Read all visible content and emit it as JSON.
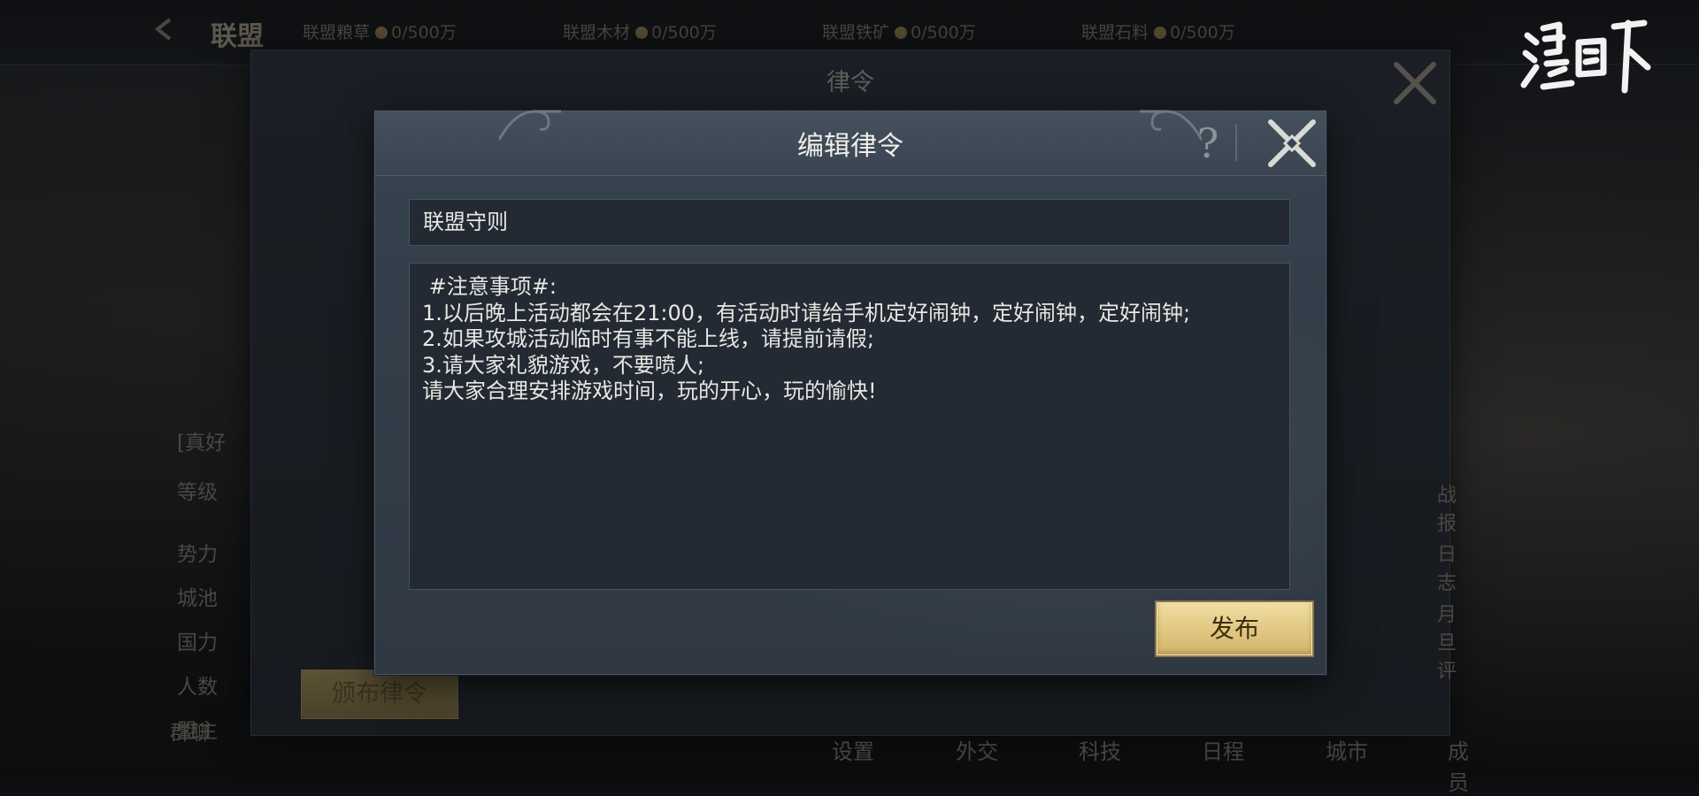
{
  "top_bar": {
    "title": "联盟",
    "resources": [
      {
        "label": "联盟粮草",
        "value": "0/500万"
      },
      {
        "label": "联盟木材",
        "value": "0/500万"
      },
      {
        "label": "联盟铁矿",
        "value": "0/500万"
      },
      {
        "label": "联盟石料",
        "value": "0/500万"
      }
    ],
    "logo_text": "鸿图之下"
  },
  "back_panel": {
    "title": "律令",
    "info_rows": [
      "[真好",
      "等级",
      "势力",
      "城池",
      "国力",
      "人数",
      "盟主",
      "群聊"
    ],
    "issue_button": "颁布律令",
    "right_links": [
      "战报",
      "日志",
      "月旦评"
    ],
    "bottom_nav": [
      "设置",
      "外交",
      "科技",
      "日程",
      "城市",
      "成员"
    ]
  },
  "dialog": {
    "title": "编辑律令",
    "help_label": "?",
    "name_value": "联盟守则",
    "content_value": " #注意事项#:\n1.以后晚上活动都会在21:00，有活动时请给手机定好闹钟，定好闹钟，定好闹钟;\n2.如果攻城活动临时有事不能上线，请提前请假;\n3.请大家礼貌游戏，不要喷人;\n请大家合理安排游戏时间，玩的开心，玩的愉快!",
    "publish_label": "发布"
  }
}
